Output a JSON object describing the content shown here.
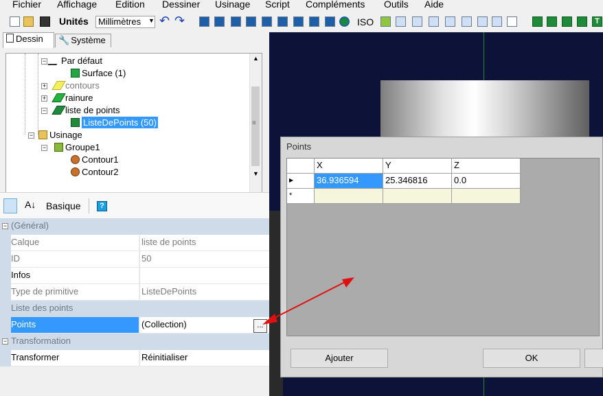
{
  "menu": [
    "Fichier",
    "Affichage",
    "Edition",
    "Dessiner",
    "Usinage",
    "Script",
    "Compléments",
    "Outils",
    "Aide"
  ],
  "toolbar": {
    "units_label": "Unités",
    "units_value": "Millimètres",
    "iso_label": "ISO",
    "t_label": "T"
  },
  "tabs": {
    "dessin": "Dessin",
    "systeme": "Système"
  },
  "tree": {
    "par_defaut": "Par défaut",
    "surface": "Surface (1)",
    "contours": "contours",
    "rainure": "rainure",
    "liste_points": "liste de points",
    "liste_de_points_50": "ListeDePoints (50)",
    "usinage": "Usinage",
    "groupe1": "Groupe1",
    "contour1": "Contour1",
    "contour2": "Contour2"
  },
  "propgrid_toolbar": {
    "basique": "Basique"
  },
  "properties": {
    "cat_general": "(Général)",
    "calque_label": "Calque",
    "calque_value": "liste de points",
    "id_label": "ID",
    "id_value": "50",
    "infos_label": "Infos",
    "infos_value": "",
    "type_label": "Type de primitive",
    "type_value": "ListeDePoints",
    "cat_liste": "Liste des points",
    "points_label": "Points",
    "points_value": "(Collection)",
    "ellipsis": "...",
    "cat_transf": "Transformation",
    "transformer_label": "Transformer",
    "transformer_value": "Réinitialiser"
  },
  "dialog": {
    "title": "Points",
    "columns": [
      "X",
      "Y",
      "Z"
    ],
    "row": {
      "x": "36.936594",
      "y": "25.346816",
      "z": "0.0"
    },
    "new_row_marker": "*",
    "add_button": "Ajouter",
    "ok_button": "OK"
  },
  "colors": {
    "viewport_bg": "#0c1238",
    "selection": "#3399ff",
    "annotation_arrow": "#e01010"
  }
}
